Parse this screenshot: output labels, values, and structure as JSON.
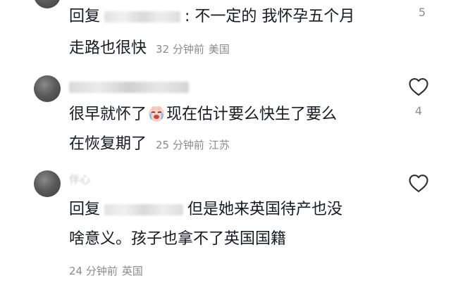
{
  "comments": [
    {
      "reply_prefix": "回复",
      "body_line1": ": 不一定的 我怀孕五个月",
      "body_line2": "走路也很快",
      "time": "32 分钟前",
      "location": "美国",
      "likes": "5"
    },
    {
      "body_line1_a": "很早就怀了",
      "emoji": "crying-face",
      "body_line1_b": "现在估计要么快生了要么",
      "body_line2": "在恢复期了",
      "time": "25 分钟前",
      "location": "江苏",
      "likes": "4"
    },
    {
      "username_visible": "伴心",
      "reply_prefix": "回复",
      "body_line1": "但是她来英国待产也没",
      "body_line2": "啥意义。孩子也拿不了英国国籍",
      "time": "24 分钟前",
      "location": "英国"
    }
  ],
  "colors": {
    "text": "#161823",
    "meta": "#8a8b91",
    "icon": "#2f3033"
  }
}
